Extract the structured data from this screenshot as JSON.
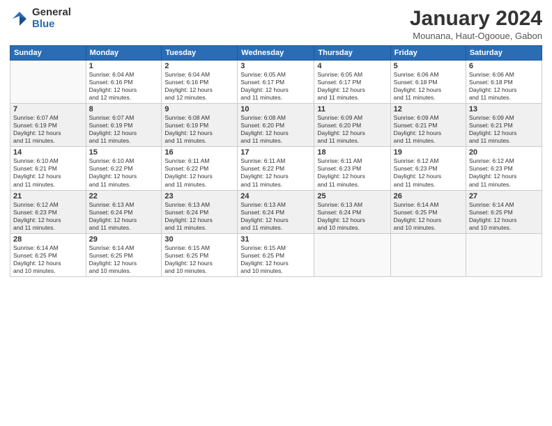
{
  "header": {
    "logo_general": "General",
    "logo_blue": "Blue",
    "title": "January 2024",
    "location": "Mounana, Haut-Ogooue, Gabon"
  },
  "days_of_week": [
    "Sunday",
    "Monday",
    "Tuesday",
    "Wednesday",
    "Thursday",
    "Friday",
    "Saturday"
  ],
  "weeks": [
    [
      {
        "day": "",
        "info": ""
      },
      {
        "day": "1",
        "info": "Sunrise: 6:04 AM\nSunset: 6:16 PM\nDaylight: 12 hours\nand 12 minutes."
      },
      {
        "day": "2",
        "info": "Sunrise: 6:04 AM\nSunset: 6:16 PM\nDaylight: 12 hours\nand 12 minutes."
      },
      {
        "day": "3",
        "info": "Sunrise: 6:05 AM\nSunset: 6:17 PM\nDaylight: 12 hours\nand 11 minutes."
      },
      {
        "day": "4",
        "info": "Sunrise: 6:05 AM\nSunset: 6:17 PM\nDaylight: 12 hours\nand 11 minutes."
      },
      {
        "day": "5",
        "info": "Sunrise: 6:06 AM\nSunset: 6:18 PM\nDaylight: 12 hours\nand 11 minutes."
      },
      {
        "day": "6",
        "info": "Sunrise: 6:06 AM\nSunset: 6:18 PM\nDaylight: 12 hours\nand 11 minutes."
      }
    ],
    [
      {
        "day": "7",
        "info": "Sunrise: 6:07 AM\nSunset: 6:19 PM\nDaylight: 12 hours\nand 11 minutes."
      },
      {
        "day": "8",
        "info": "Sunrise: 6:07 AM\nSunset: 6:19 PM\nDaylight: 12 hours\nand 11 minutes."
      },
      {
        "day": "9",
        "info": "Sunrise: 6:08 AM\nSunset: 6:19 PM\nDaylight: 12 hours\nand 11 minutes."
      },
      {
        "day": "10",
        "info": "Sunrise: 6:08 AM\nSunset: 6:20 PM\nDaylight: 12 hours\nand 11 minutes."
      },
      {
        "day": "11",
        "info": "Sunrise: 6:09 AM\nSunset: 6:20 PM\nDaylight: 12 hours\nand 11 minutes."
      },
      {
        "day": "12",
        "info": "Sunrise: 6:09 AM\nSunset: 6:21 PM\nDaylight: 12 hours\nand 11 minutes."
      },
      {
        "day": "13",
        "info": "Sunrise: 6:09 AM\nSunset: 6:21 PM\nDaylight: 12 hours\nand 11 minutes."
      }
    ],
    [
      {
        "day": "14",
        "info": "Sunrise: 6:10 AM\nSunset: 6:21 PM\nDaylight: 12 hours\nand 11 minutes."
      },
      {
        "day": "15",
        "info": "Sunrise: 6:10 AM\nSunset: 6:22 PM\nDaylight: 12 hours\nand 11 minutes."
      },
      {
        "day": "16",
        "info": "Sunrise: 6:11 AM\nSunset: 6:22 PM\nDaylight: 12 hours\nand 11 minutes."
      },
      {
        "day": "17",
        "info": "Sunrise: 6:11 AM\nSunset: 6:22 PM\nDaylight: 12 hours\nand 11 minutes."
      },
      {
        "day": "18",
        "info": "Sunrise: 6:11 AM\nSunset: 6:23 PM\nDaylight: 12 hours\nand 11 minutes."
      },
      {
        "day": "19",
        "info": "Sunrise: 6:12 AM\nSunset: 6:23 PM\nDaylight: 12 hours\nand 11 minutes."
      },
      {
        "day": "20",
        "info": "Sunrise: 6:12 AM\nSunset: 6:23 PM\nDaylight: 12 hours\nand 11 minutes."
      }
    ],
    [
      {
        "day": "21",
        "info": "Sunrise: 6:12 AM\nSunset: 6:23 PM\nDaylight: 12 hours\nand 11 minutes."
      },
      {
        "day": "22",
        "info": "Sunrise: 6:13 AM\nSunset: 6:24 PM\nDaylight: 12 hours\nand 11 minutes."
      },
      {
        "day": "23",
        "info": "Sunrise: 6:13 AM\nSunset: 6:24 PM\nDaylight: 12 hours\nand 11 minutes."
      },
      {
        "day": "24",
        "info": "Sunrise: 6:13 AM\nSunset: 6:24 PM\nDaylight: 12 hours\nand 11 minutes."
      },
      {
        "day": "25",
        "info": "Sunrise: 6:13 AM\nSunset: 6:24 PM\nDaylight: 12 hours\nand 10 minutes."
      },
      {
        "day": "26",
        "info": "Sunrise: 6:14 AM\nSunset: 6:25 PM\nDaylight: 12 hours\nand 10 minutes."
      },
      {
        "day": "27",
        "info": "Sunrise: 6:14 AM\nSunset: 6:25 PM\nDaylight: 12 hours\nand 10 minutes."
      }
    ],
    [
      {
        "day": "28",
        "info": "Sunrise: 6:14 AM\nSunset: 6:25 PM\nDaylight: 12 hours\nand 10 minutes."
      },
      {
        "day": "29",
        "info": "Sunrise: 6:14 AM\nSunset: 6:25 PM\nDaylight: 12 hours\nand 10 minutes."
      },
      {
        "day": "30",
        "info": "Sunrise: 6:15 AM\nSunset: 6:25 PM\nDaylight: 12 hours\nand 10 minutes."
      },
      {
        "day": "31",
        "info": "Sunrise: 6:15 AM\nSunset: 6:25 PM\nDaylight: 12 hours\nand 10 minutes."
      },
      {
        "day": "",
        "info": ""
      },
      {
        "day": "",
        "info": ""
      },
      {
        "day": "",
        "info": ""
      }
    ]
  ]
}
